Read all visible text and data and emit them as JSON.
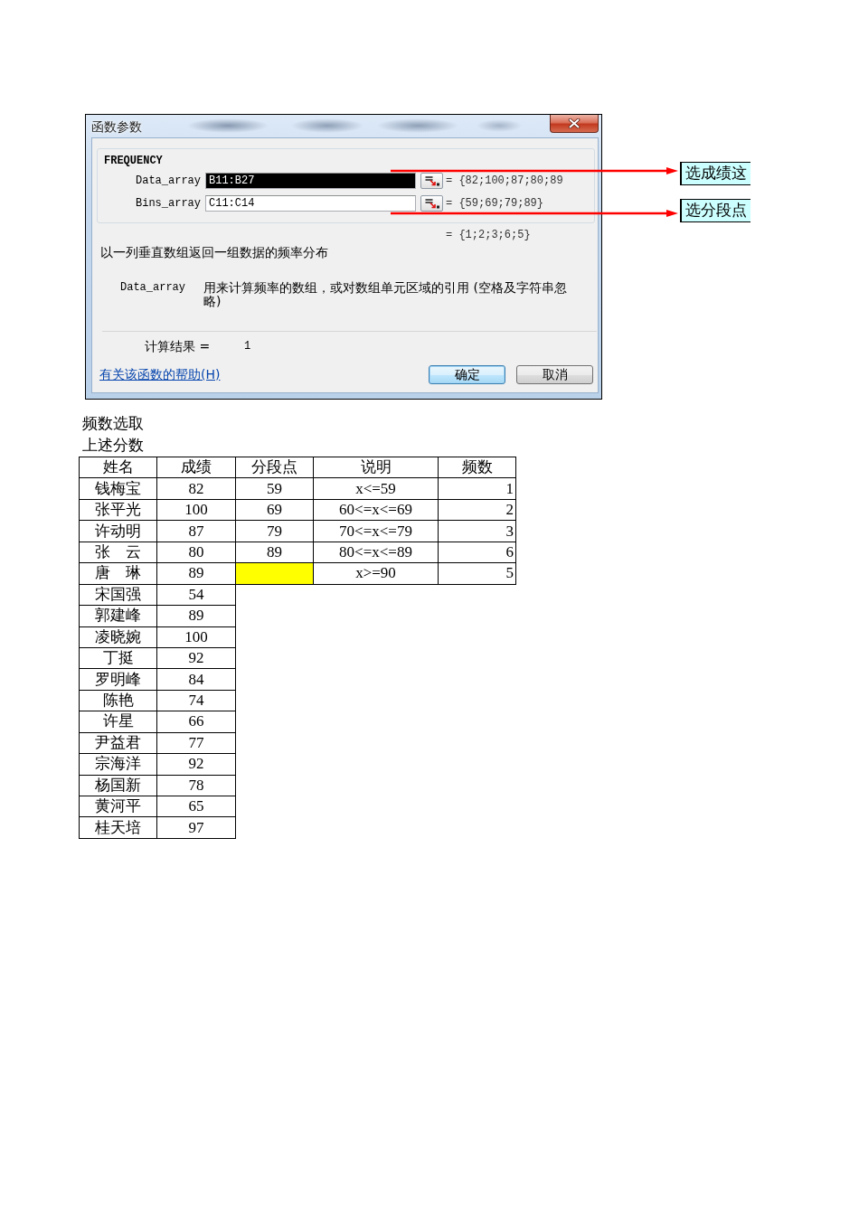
{
  "dialog": {
    "title": "函数参数",
    "function_name": "FREQUENCY",
    "arguments": [
      {
        "label": "Data_array",
        "value": "B11:B27",
        "text_selected": true,
        "preview": "= {82;100;87;80;89"
      },
      {
        "label": "Bins_array",
        "value": "C11:C14",
        "text_selected": false,
        "preview": "= {59;69;79;89}"
      }
    ],
    "result_preview": "= {1;2;3;6;5}",
    "description": "以一列垂直数组返回一组数据的频率分布",
    "argument_help": {
      "label": "Data_array",
      "text": "用来计算频率的数组，或对数组单元区域的引用 (空格及字符串忽略)"
    },
    "result": {
      "label": "计算结果 =",
      "value": "1"
    },
    "help_link": "有关该函数的帮助(H)",
    "buttons": [
      {
        "label": "确定",
        "default": true
      },
      {
        "label": "取消",
        "default": false
      }
    ]
  },
  "callouts": [
    {
      "text": "选成绩这"
    },
    {
      "text": "选分段点"
    }
  ],
  "note": "频数选取上述分数",
  "table": {
    "columns": [
      "姓名",
      "成绩",
      "分段点",
      "说明",
      "频数"
    ],
    "rows": [
      {
        "name": "钱梅宝",
        "score": "82",
        "bin": {
          "value": "59",
          "highlighted": false
        },
        "range": "x<=59",
        "frequency": "1"
      },
      {
        "name": "张平光",
        "score": "100",
        "bin": {
          "value": "69",
          "highlighted": false
        },
        "range": "60<=x<=69",
        "frequency": "2"
      },
      {
        "name": "许动明",
        "score": "87",
        "bin": {
          "value": "79",
          "highlighted": false
        },
        "range": "70<=x<=79",
        "frequency": "3"
      },
      {
        "name": "张　云",
        "score": "80",
        "bin": {
          "value": "89",
          "highlighted": false
        },
        "range": "80<=x<=89",
        "frequency": "6"
      },
      {
        "name": "唐　琳",
        "score": "89",
        "bin": {
          "highlighted": true
        },
        "range": "x>=90",
        "frequency": "5"
      },
      {
        "name": "宋国强",
        "score": "54"
      },
      {
        "name": "郭建峰",
        "score": "89"
      },
      {
        "name": "凌晓婉",
        "score": "100"
      },
      {
        "name": "丁挺",
        "score": "92"
      },
      {
        "name": "罗明峰",
        "score": "84"
      },
      {
        "name": "陈艳",
        "score": "74"
      },
      {
        "name": "许星",
        "score": "66"
      },
      {
        "name": "尹益君",
        "score": "77"
      },
      {
        "name": "宗海洋",
        "score": "92"
      },
      {
        "name": "杨国新",
        "score": "78"
      },
      {
        "name": "黄河平",
        "score": "65"
      },
      {
        "name": "桂天培",
        "score": "97"
      }
    ]
  }
}
